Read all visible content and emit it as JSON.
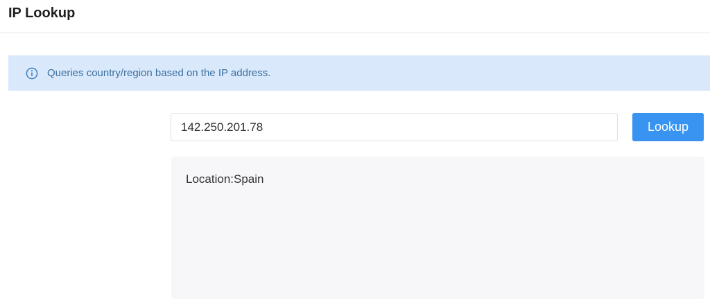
{
  "header": {
    "title": "IP Lookup"
  },
  "info_banner": {
    "icon": "info-circle-icon",
    "text": "Queries country/region based on the IP address.",
    "background_color": "#d9e9fb",
    "text_color": "#3a6fa0"
  },
  "lookup_form": {
    "ip_value": "142.250.201.78",
    "button_label": "Lookup",
    "button_color": "#3894f0"
  },
  "result": {
    "text": "Location:Spain"
  }
}
